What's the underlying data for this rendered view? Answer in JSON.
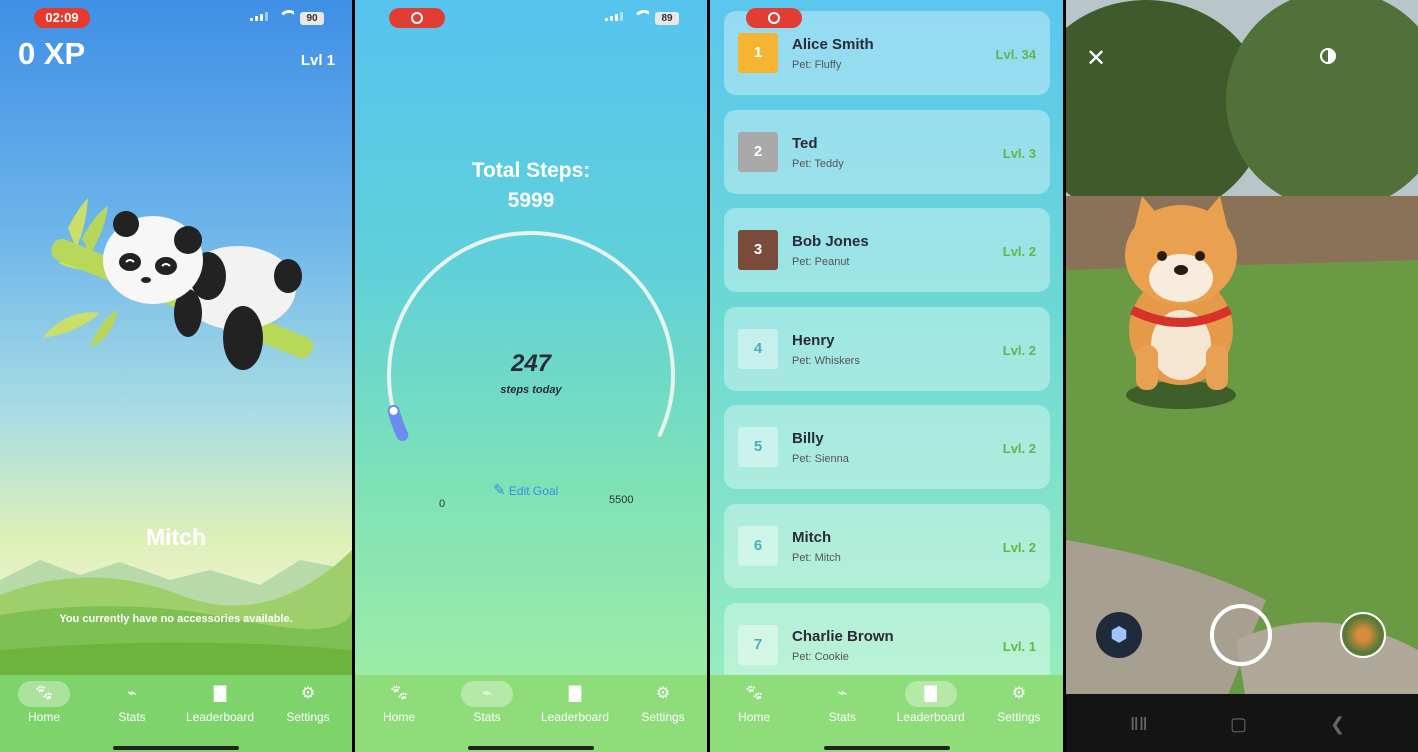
{
  "screen1": {
    "time": "02:09",
    "battery": "90",
    "xp": "0 XP",
    "level": "Lvl 1",
    "pet_name": "Mitch",
    "accessories_msg": "You currently have no accessories available."
  },
  "screen2": {
    "battery": "89",
    "total_label": "Total Steps:",
    "total_value": "5999",
    "today_value": "247",
    "today_label": "steps today",
    "min": "0",
    "goal": "5500",
    "edit_goal": "Edit Goal",
    "progress_fraction": 0.045
  },
  "screen3": {
    "entries": [
      {
        "rank": "1",
        "name": "Alice Smith",
        "pet": "Pet: Fluffy",
        "level": "Lvl. 34",
        "color": "#f5b432"
      },
      {
        "rank": "2",
        "name": "Ted",
        "pet": "Pet: Teddy",
        "level": "Lvl. 3",
        "color": "#a9a9a9"
      },
      {
        "rank": "3",
        "name": "Bob Jones",
        "pet": "Pet: Peanut",
        "level": "Lvl. 2",
        "color": "#7a4a3a"
      },
      {
        "rank": "4",
        "name": "Henry",
        "pet": "Pet: Whiskers",
        "level": "Lvl. 2",
        "color": "rgba(255,255,255,0.4)"
      },
      {
        "rank": "5",
        "name": "Billy",
        "pet": "Pet: Sienna",
        "level": "Lvl. 2",
        "color": "rgba(255,255,255,0.4)"
      },
      {
        "rank": "6",
        "name": "Mitch",
        "pet": "Pet: Mitch",
        "level": "Lvl. 2",
        "color": "rgba(255,255,255,0.4)"
      },
      {
        "rank": "7",
        "name": "Charlie Brown",
        "pet": "Pet: Cookie",
        "level": "Lvl. 1",
        "color": "rgba(255,255,255,0.4)"
      }
    ]
  },
  "tabs": {
    "home": "Home",
    "stats": "Stats",
    "leaderboard": "Leaderboard",
    "settings": "Settings"
  },
  "icons": {
    "home": "paw-icon",
    "stats": "running-icon",
    "leaderboard": "bar-chart-icon",
    "settings": "people-gear-icon"
  },
  "colors": {
    "tab_bg": "#7ed36b",
    "rank1": "#f5b432",
    "accent": "#3b8be0"
  }
}
